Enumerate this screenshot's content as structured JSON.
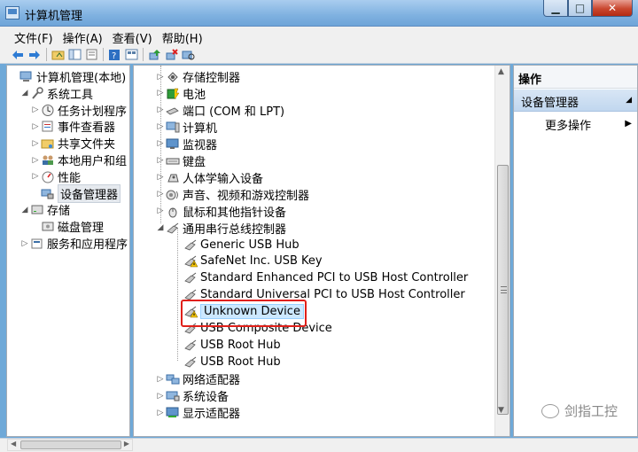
{
  "window": {
    "title": "计算机管理"
  },
  "menu": [
    "文件(F)",
    "操作(A)",
    "查看(V)",
    "帮助(H)"
  ],
  "toolbar_icons": [
    "back-icon",
    "forward-icon",
    "up-folder-icon",
    "show-tree-icon",
    "properties-icon",
    "list-icon",
    "help-icon",
    "details-icon",
    "update-driver-icon",
    "uninstall-icon",
    "scan-hardware-icon"
  ],
  "left_tree": [
    {
      "label": "计算机管理(本地)",
      "icon": "computer-mgmt-icon",
      "arrow": "",
      "level": 0
    },
    {
      "label": "系统工具",
      "icon": "tools-icon",
      "arrow": "◢",
      "level": 1
    },
    {
      "label": "任务计划程序",
      "icon": "clock-icon",
      "arrow": "▷",
      "level": 2
    },
    {
      "label": "事件查看器",
      "icon": "event-viewer-icon",
      "arrow": "▷",
      "level": 2
    },
    {
      "label": "共享文件夹",
      "icon": "shared-folder-icon",
      "arrow": "▷",
      "level": 2
    },
    {
      "label": "本地用户和组",
      "icon": "users-icon",
      "arrow": "▷",
      "level": 2
    },
    {
      "label": "性能",
      "icon": "performance-icon",
      "arrow": "▷",
      "level": 2
    },
    {
      "label": "设备管理器",
      "icon": "device-manager-icon",
      "arrow": "",
      "level": 2,
      "selected": true
    },
    {
      "label": "存储",
      "icon": "storage-icon",
      "arrow": "◢",
      "level": 1
    },
    {
      "label": "磁盘管理",
      "icon": "disk-icon",
      "arrow": "",
      "level": 2
    },
    {
      "label": "服务和应用程序",
      "icon": "services-icon",
      "arrow": "▷",
      "level": 1
    }
  ],
  "device_tree": [
    {
      "label": "存储控制器",
      "icon": "storage-controller-icon",
      "arrow": "▷",
      "level": 0
    },
    {
      "label": "电池",
      "icon": "battery-icon",
      "arrow": "▷",
      "level": 0
    },
    {
      "label": "端口 (COM 和 LPT)",
      "icon": "port-icon",
      "arrow": "▷",
      "level": 0
    },
    {
      "label": "计算机",
      "icon": "computer-icon",
      "arrow": "▷",
      "level": 0
    },
    {
      "label": "监视器",
      "icon": "monitor-icon",
      "arrow": "▷",
      "level": 0
    },
    {
      "label": "键盘",
      "icon": "keyboard-icon",
      "arrow": "▷",
      "level": 0
    },
    {
      "label": "人体学输入设备",
      "icon": "hid-icon",
      "arrow": "▷",
      "level": 0
    },
    {
      "label": "声音、视频和游戏控制器",
      "icon": "sound-icon",
      "arrow": "▷",
      "level": 0
    },
    {
      "label": "鼠标和其他指针设备",
      "icon": "mouse-icon",
      "arrow": "▷",
      "level": 0
    },
    {
      "label": "通用串行总线控制器",
      "icon": "usb-controller-icon",
      "arrow": "◢",
      "level": 0
    },
    {
      "label": "Generic USB Hub",
      "icon": "usb-device-icon",
      "arrow": "",
      "level": 1
    },
    {
      "label": "SafeNet Inc. USB Key",
      "icon": "usb-warning-icon",
      "arrow": "",
      "level": 1
    },
    {
      "label": "Standard Enhanced PCI to USB Host Controller",
      "icon": "usb-device-icon",
      "arrow": "",
      "level": 1
    },
    {
      "label": "Standard Universal PCI to USB Host Controller",
      "icon": "usb-device-icon",
      "arrow": "",
      "level": 1
    },
    {
      "label": "Unknown Device",
      "icon": "usb-warning-icon",
      "arrow": "",
      "level": 1,
      "selected": true
    },
    {
      "label": "USB Composite Device",
      "icon": "usb-device-icon",
      "arrow": "",
      "level": 1
    },
    {
      "label": "USB Root Hub",
      "icon": "usb-device-icon",
      "arrow": "",
      "level": 1
    },
    {
      "label": "USB Root Hub",
      "icon": "usb-device-icon",
      "arrow": "",
      "level": 1
    },
    {
      "label": "网络适配器",
      "icon": "network-icon",
      "arrow": "▷",
      "level": 0
    },
    {
      "label": "系统设备",
      "icon": "system-device-icon",
      "arrow": "▷",
      "level": 0
    },
    {
      "label": "显示适配器",
      "icon": "display-adapter-icon",
      "arrow": "▷",
      "level": 0
    }
  ],
  "actions": {
    "header": "操作",
    "section": "设备管理器",
    "more": "更多操作"
  },
  "watermark": "剑指工控",
  "colors": {
    "highlight": "#e0201a",
    "warning": "#f5c400"
  }
}
